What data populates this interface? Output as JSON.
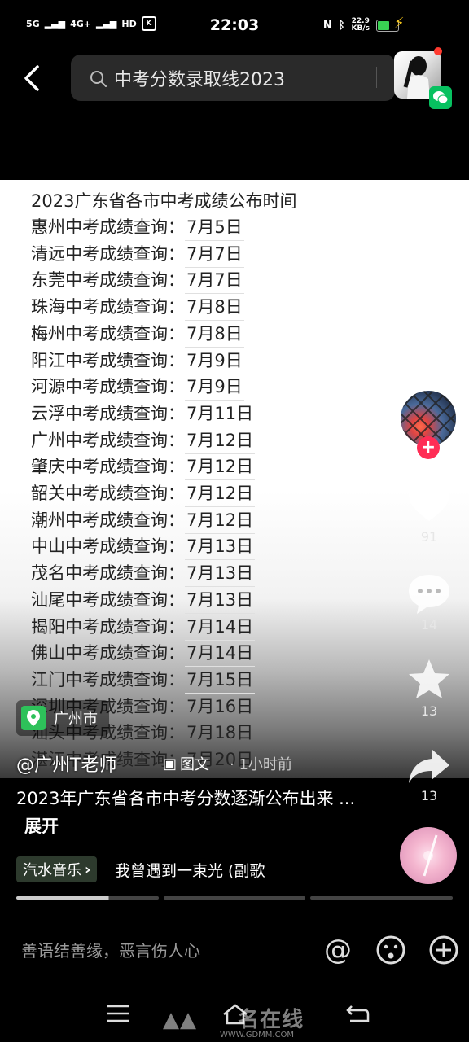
{
  "status_bar": {
    "signal1": "5G",
    "signal2": "4G+",
    "hd": "HD",
    "k": "K",
    "time": "22:03",
    "nfc": "N",
    "speed": "22.9",
    "speed_unit": "KB/s"
  },
  "search": {
    "query": "中考分数录取线2023"
  },
  "document": {
    "title": "2023广东省各市中考成绩公布时间",
    "rows": [
      {
        "label": "惠州中考成绩查询：",
        "date": "7月5日"
      },
      {
        "label": "清远中考成绩查询：",
        "date": "7月7日"
      },
      {
        "label": "东莞中考成绩查询：",
        "date": "7月7日"
      },
      {
        "label": "珠海中考成绩查询：",
        "date": "7月8日"
      },
      {
        "label": "梅州中考成绩查询：",
        "date": "7月8日"
      },
      {
        "label": "阳江中考成绩查询：",
        "date": "7月9日"
      },
      {
        "label": "河源中考成绩查询：",
        "date": "7月9日"
      },
      {
        "label": "云浮中考成绩查询：",
        "date": "7月11日"
      },
      {
        "label": "广州中考成绩查询：",
        "date": "7月12日"
      },
      {
        "label": "肇庆中考成绩查询：",
        "date": "7月12日"
      },
      {
        "label": "韶关中考成绩查询：",
        "date": "7月12日"
      },
      {
        "label": "潮州中考成绩查询：",
        "date": "7月12日"
      },
      {
        "label": "中山中考成绩查询：",
        "date": "7月13日"
      },
      {
        "label": "茂名中考成绩查询：",
        "date": "7月13日"
      },
      {
        "label": "汕尾中考成绩查询：",
        "date": "7月13日"
      },
      {
        "label": "揭阳中考成绩查询：",
        "date": "7月14日"
      },
      {
        "label": "佛山中考成绩查询：",
        "date": "7月14日"
      },
      {
        "label": "江门中考成绩查询：",
        "date": "7月15日"
      },
      {
        "label": "深圳中考成绩查询：",
        "date": "7月16日"
      },
      {
        "label": "汕头中考成绩查询：",
        "date": "7月18日"
      },
      {
        "label": "湛江中考成绩查询：",
        "date": "7月20日"
      }
    ]
  },
  "actions": {
    "likes": "91",
    "comments": "14",
    "favorites": "13",
    "shares": "13"
  },
  "post": {
    "location": "广州市",
    "author": "@广州T老师",
    "type": "图文",
    "time": "1小时前",
    "caption": "2023年广东省各市中考分数逐渐公布出来 ...",
    "expand": "展开",
    "music_tag": "汽水音乐",
    "music_title": "我曾遇到一束光 (副歌"
  },
  "comment_bar": {
    "placeholder": "善语结善缘，恶言伤人心"
  },
  "watermark": {
    "text": "GDMM",
    "brand": "名在线",
    "url": "WWW.GDMM.COM"
  },
  "colors": {
    "accent_red": "#ff2d55",
    "location_green": "#2ec15a",
    "wechat_green": "#07c160"
  }
}
